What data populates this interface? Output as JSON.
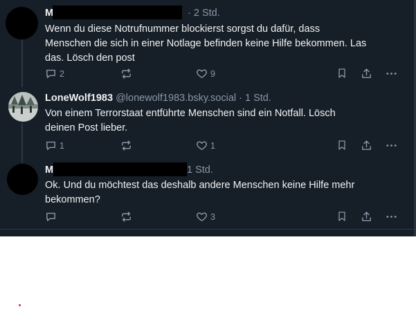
{
  "posts": [
    {
      "author_initial": "M",
      "handle": "",
      "time": "· 2 Std.",
      "text_lines": [
        "Wenn du diese Notrufnummer blockierst sorgst du dafür, dass",
        "Menschen die sich in einer Notlage befinden keine Hilfe bekommen. Las",
        "das. Lösch den post"
      ],
      "replies": "2",
      "reposts": "",
      "likes": "9"
    },
    {
      "author_initial": "LoneWolf1983",
      "handle": "@lonewolf1983.bsky.social",
      "time": "· 1 Std.",
      "text_lines": [
        "Von einem Terrorstaat entführte Menschen sind ein Notfall. Lösch",
        "deinen Post lieber."
      ],
      "replies": "1",
      "reposts": "",
      "likes": "1"
    },
    {
      "author_initial": "M",
      "handle": "",
      "time": "1 Std.",
      "text_lines": [
        "Ok. Und du möchtest das deshalb andere Menschen keine Hilfe mehr",
        "bekommen?"
      ],
      "replies": "",
      "reposts": "",
      "likes": "3"
    }
  ],
  "icons": {
    "reply": "speech-bubble-icon",
    "repost": "repost-arrows-icon",
    "like": "heart-icon",
    "bookmark": "bookmark-icon",
    "share": "share-icon",
    "more": "more-dots-icon"
  },
  "colors": {
    "background": "#161e27",
    "text": "#f1f3f5",
    "muted": "#8b98a9"
  }
}
